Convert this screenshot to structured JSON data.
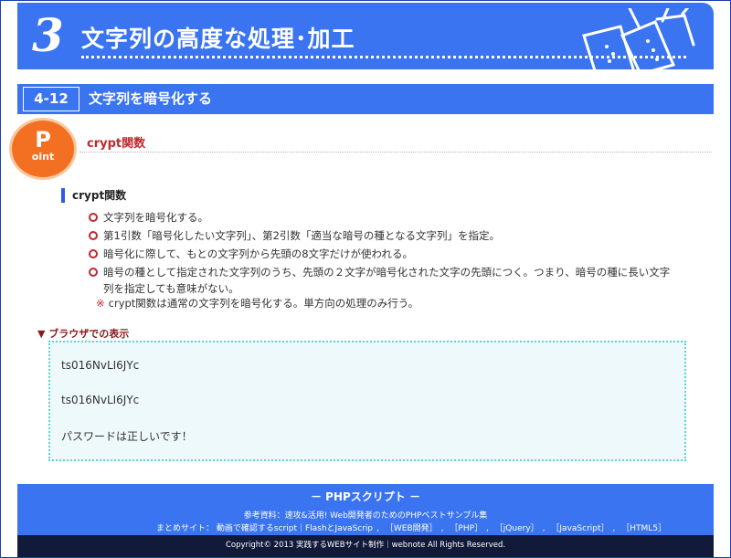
{
  "chapter": {
    "number": "3",
    "title": "文字列の高度な処理･加工"
  },
  "section": {
    "number": "4-12",
    "title": "文字列を暗号化する"
  },
  "point": {
    "badge_big": "P",
    "badge_small": "oint",
    "heading": "crypt関数"
  },
  "content": {
    "subheading": "crypt関数",
    "bullets": [
      "文字列を暗号化する。",
      "第1引数「暗号化したい文字列」、第2引数「適当な暗号の種となる文字列」を指定。",
      "暗号化に際して、もとの文字列から先頭の8文字だけが使われる。",
      "暗号の種として指定された文字列のうち、先頭の２文字が暗号化された文字の先頭につく。つまり、暗号の種に長い文字列を指定しても意味がない。"
    ],
    "note_mark": "※",
    "note": "crypt関数は通常の文字列を暗号化する。単方向の処理のみ行う。"
  },
  "browser": {
    "label": "▼ ブラウザでの表示",
    "lines": [
      "ts016NvLI6JYc",
      "ts016NvLI6JYc",
      "パスワードは正しいです！"
    ]
  },
  "footer": {
    "title": "－ PHPスクリプト －",
    "ref_prefix": "参考資料：",
    "ref_link": "速攻&活用! Web開発者のためのPHPベストサンプル集",
    "sites_prefix": "まとめサイト：",
    "sites": [
      "動画で確認するscript｜FlashとJavaScrip",
      "［WEB開発］",
      "［PHP］",
      "［jQuery］",
      "［JavaScript］",
      "［HTML5］"
    ],
    "copyright": "Copyright© 2013 実践するWEBサイト制作｜webnote All Rights Reserved."
  },
  "colors": {
    "primary": "#3a74f0",
    "accent": "#c0282d",
    "badge": "#f36f22",
    "dark": "#121a3a"
  }
}
